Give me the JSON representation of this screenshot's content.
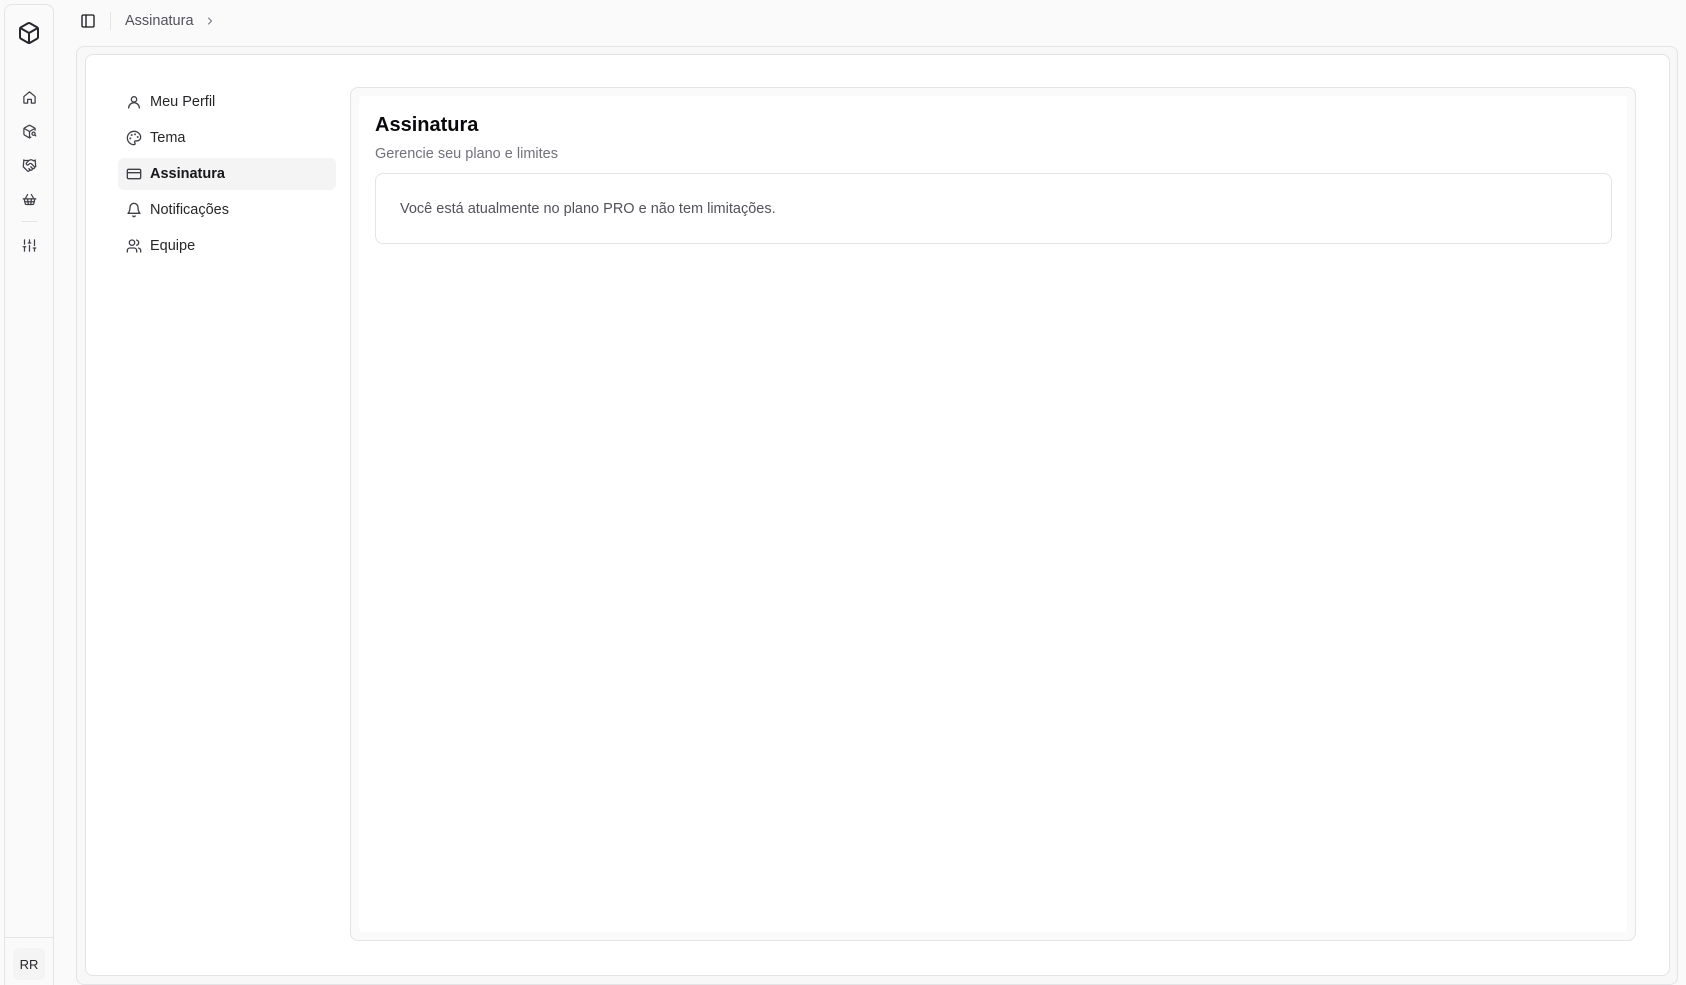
{
  "rail": {
    "icons": [
      "package-icon",
      "home-icon",
      "package-search-icon",
      "handshake-icon",
      "basket-icon",
      "sliders-icon"
    ],
    "avatar_initials": "RR"
  },
  "topbar": {
    "breadcrumb": [
      "Assinatura"
    ]
  },
  "settings_nav": {
    "items": [
      {
        "label": "Meu Perfil",
        "icon": "user-icon",
        "active": false
      },
      {
        "label": "Tema",
        "icon": "palette-icon",
        "active": false
      },
      {
        "label": "Assinatura",
        "icon": "credit-card-icon",
        "active": true
      },
      {
        "label": "Notificações",
        "icon": "bell-icon",
        "active": false
      },
      {
        "label": "Equipe",
        "icon": "users-icon",
        "active": false
      }
    ]
  },
  "main": {
    "title": "Assinatura",
    "subtitle": "Gerencie seu plano e limites",
    "plan_message": "Você está atualmente no plano PRO e não tem limitações."
  },
  "colors": {
    "border": "#e4e4e7",
    "active_bg": "#f4f4f5",
    "muted_text": "#71717a"
  }
}
